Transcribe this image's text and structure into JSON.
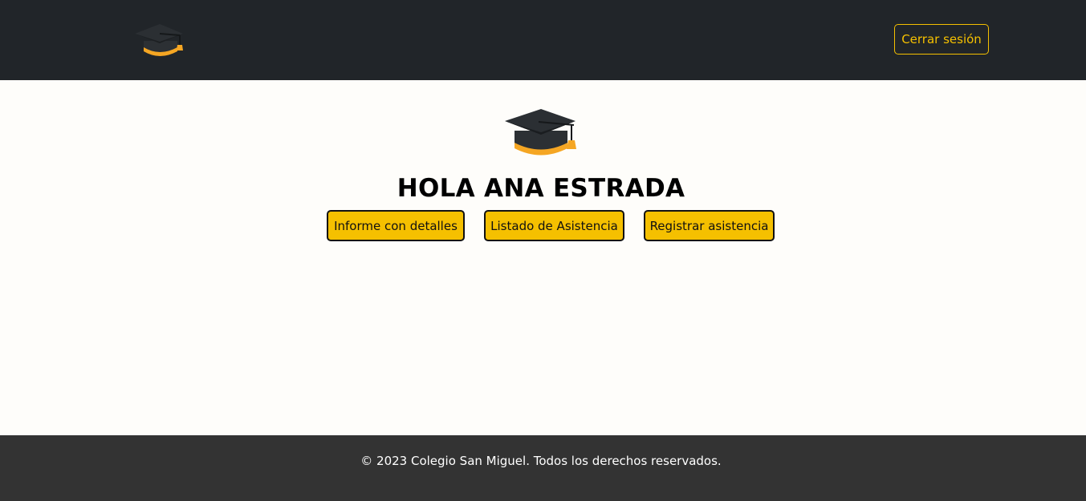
{
  "header": {
    "logo_icon": "graduation-cap-icon",
    "logout_label": "Cerrar sesión"
  },
  "main": {
    "logo_icon": "graduation-cap-icon",
    "greeting": "HOLA ANA ESTRADA",
    "buttons": {
      "report": "Informe con detalles",
      "attendance_list": "Listado de Asistencia",
      "register_attendance": "Registrar asistencia"
    }
  },
  "footer": {
    "copyright": "© 2023 Colegio San Miguel. Todos los derechos reservados."
  },
  "colors": {
    "header_bg": "#212529",
    "accent": "#f5c000",
    "page_bg": "#fefdfa",
    "footer_bg": "#333333",
    "cap_band": "#f5a623"
  }
}
